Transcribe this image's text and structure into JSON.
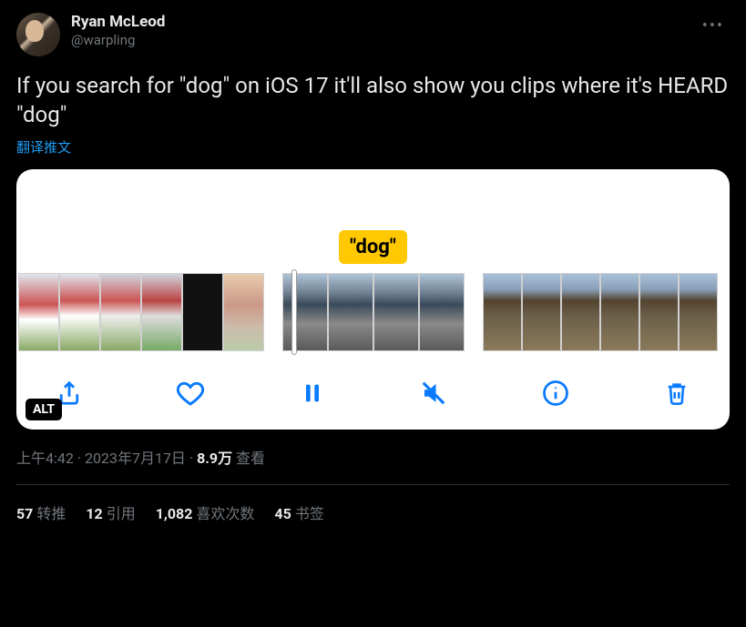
{
  "author": {
    "display_name": "Ryan McLeod",
    "handle": "@warpling"
  },
  "tweet_text": "If you search for \"dog\" on iOS 17 it'll also show you clips where it's HEARD \"dog\"",
  "translate_label": "翻译推文",
  "media": {
    "caption_bubble": "\"dog\"",
    "alt_badge": "ALT"
  },
  "meta": {
    "time": "上午4:42",
    "date": "2023年7月17日",
    "views_count": "8.9万",
    "views_label": "查看"
  },
  "stats": {
    "retweets_count": "57",
    "retweets_label": "转推",
    "quotes_count": "12",
    "quotes_label": "引用",
    "likes_count": "1,082",
    "likes_label": "喜欢次数",
    "bookmarks_count": "45",
    "bookmarks_label": "书签"
  }
}
